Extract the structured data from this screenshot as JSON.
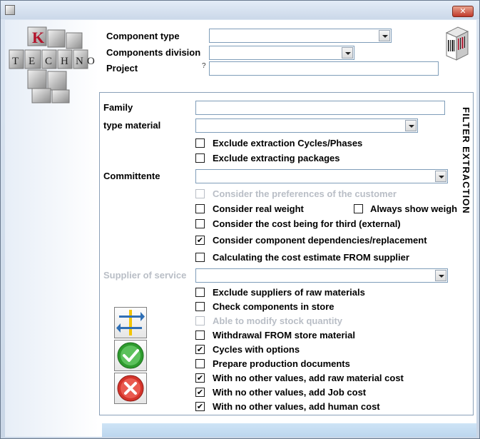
{
  "window": {
    "close_label": "✕"
  },
  "header": {
    "component_type_label": "Component type",
    "components_division_label": "Components division",
    "project_label": "Project",
    "project_hint": "?"
  },
  "filter": {
    "panel_title": "FILTER EXTRACTION",
    "family_label": "Family",
    "type_material_label": "type material",
    "committente_label": "Committente",
    "supplier_label": "Supplier of service"
  },
  "options": [
    {
      "label": "Exclude extraction Cycles/Phases",
      "checked": false,
      "disabled": false
    },
    {
      "label": "Exclude extracting packages",
      "checked": false,
      "disabled": false
    },
    {
      "label": "Consider the preferences of the customer",
      "checked": false,
      "disabled": true
    },
    {
      "label": "Consider real weight",
      "checked": false,
      "disabled": false
    },
    {
      "label": "Consider the cost being for third (external)",
      "checked": false,
      "disabled": false
    },
    {
      "label": "Consider component dependencies/replacement",
      "checked": true,
      "disabled": false
    },
    {
      "label": "Calculating the cost estimate FROM supplier",
      "checked": false,
      "disabled": false
    },
    {
      "label": "Exclude suppliers of raw materials",
      "checked": false,
      "disabled": false
    },
    {
      "label": "Check components in store",
      "checked": false,
      "disabled": false
    },
    {
      "label": "Able to modify stock quantity",
      "checked": false,
      "disabled": true
    },
    {
      "label": "Withdrawal FROM store material",
      "checked": false,
      "disabled": false
    },
    {
      "label": "Cycles with options",
      "checked": true,
      "disabled": false
    },
    {
      "label": "Prepare production documents",
      "checked": false,
      "disabled": false
    },
    {
      "label": "With no other values, add raw material cost",
      "checked": true,
      "disabled": false
    },
    {
      "label": "With no other values, add Job cost",
      "checked": true,
      "disabled": false
    },
    {
      "label": "With no other values, add human cost",
      "checked": true,
      "disabled": false
    }
  ],
  "always_show_weight": {
    "label": "Always show weigh",
    "checked": false
  },
  "logo": {
    "letters": [
      "K",
      "T",
      "E",
      "C",
      "H",
      "N",
      "O"
    ]
  },
  "icons": {
    "barcode": "barcode-icon",
    "transfer": "transfer-arrows-icon",
    "confirm": "green-check-icon",
    "cancel": "red-x-icon"
  },
  "colors": {
    "check_green": "#2e9b2e",
    "cancel_red": "#d4342b",
    "arrow_blue": "#2f6fb5",
    "bar_yellow": "#f2c400"
  }
}
